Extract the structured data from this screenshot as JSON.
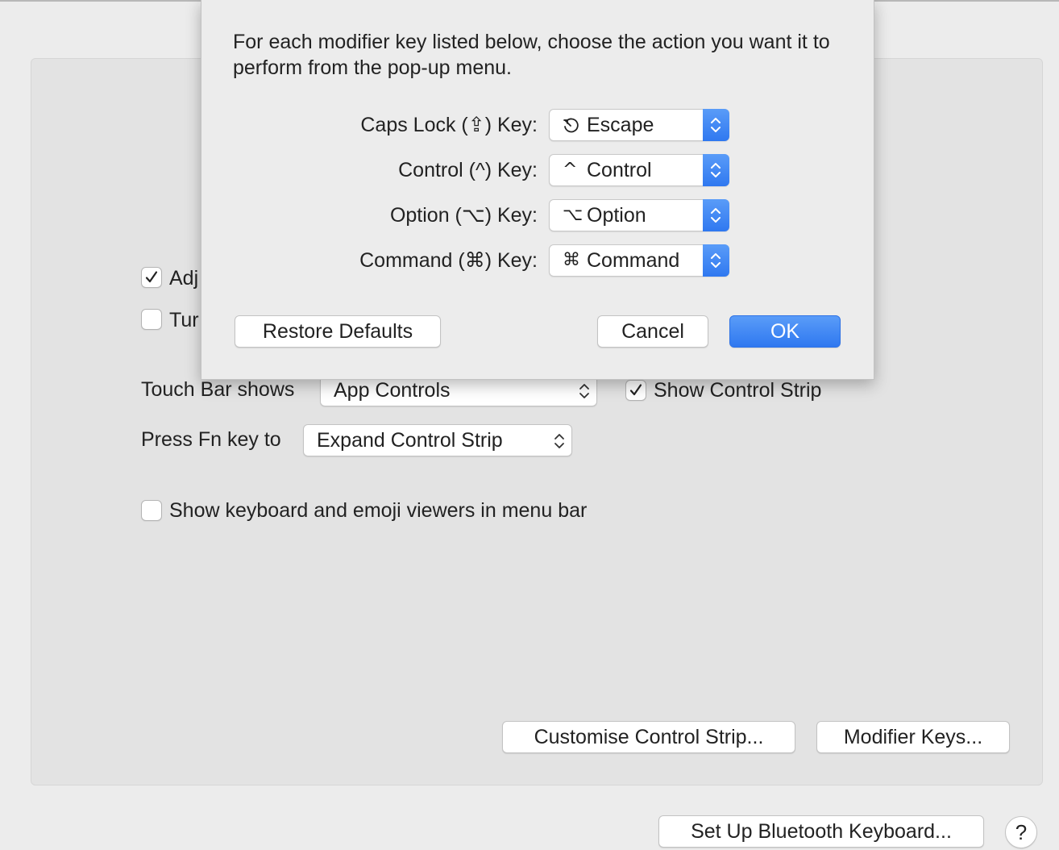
{
  "background": {
    "adjust_checkbox": {
      "label": "Adj",
      "checked": true
    },
    "turn_checkbox": {
      "label": "Tur",
      "checked": false
    },
    "touch_bar": {
      "label": "Touch Bar shows",
      "value": "App Controls"
    },
    "show_control_strip": {
      "label": "Show Control Strip",
      "checked": true
    },
    "fn_key": {
      "label": "Press Fn key to",
      "value": "Expand Control Strip"
    },
    "show_viewers": {
      "label": "Show keyboard and emoji viewers in menu bar",
      "checked": false
    },
    "customise_button": "Customise Control Strip...",
    "modifier_button": "Modifier Keys...",
    "bluetooth_button": "Set Up Bluetooth Keyboard...",
    "help_button": "?"
  },
  "sheet": {
    "intro": "For each modifier key listed below, choose the action you want it to perform from the pop-up menu.",
    "rows": [
      {
        "label": "Caps Lock (⇪) Key:",
        "glyph": "⎋",
        "value": "Escape"
      },
      {
        "label": "Control (^) Key:",
        "glyph": "^",
        "value": "Control"
      },
      {
        "label": "Option (⌥) Key:",
        "glyph": "⌥",
        "value": "Option"
      },
      {
        "label": "Command (⌘) Key:",
        "glyph": "⌘",
        "value": "Command"
      }
    ],
    "restore_button": "Restore Defaults",
    "cancel_button": "Cancel",
    "ok_button": "OK"
  },
  "colors": {
    "accent": "#2f78f0",
    "window_bg": "#ececec",
    "panel_bg": "#e3e3e3"
  }
}
